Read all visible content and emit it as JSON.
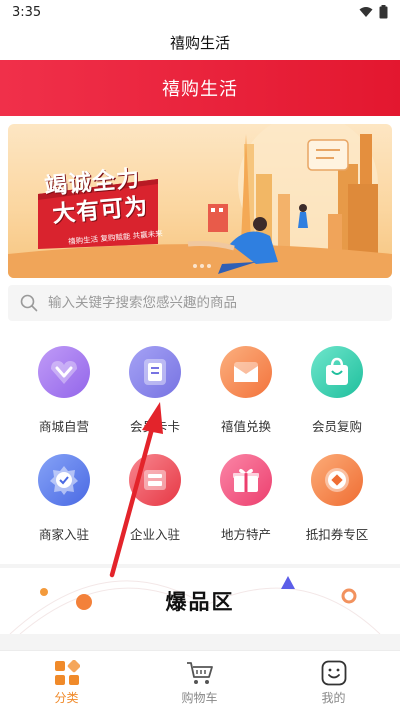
{
  "status_bar": {
    "time": "3:35"
  },
  "header": {
    "title": "禧购生活"
  },
  "red_bar": {
    "title": "禧购生活"
  },
  "banner": {
    "headline_1": "竭诚全力",
    "headline_2": "大有可为",
    "tagline": "禧购生活 复购赋能 共赢未来"
  },
  "search": {
    "placeholder": "输入关键字搜索您感兴趣的商品"
  },
  "grid": {
    "items": [
      {
        "label": "商城自营",
        "icon": "heart-v-icon",
        "color": "#a77cf2"
      },
      {
        "label": "会员卡卡",
        "icon": "member-card-icon",
        "color": "#8b87e8"
      },
      {
        "label": "禧值兑换",
        "icon": "exchange-icon",
        "color": "#f9935a"
      },
      {
        "label": "会员复购",
        "icon": "shopping-bag-icon",
        "color": "#39d3b5"
      },
      {
        "label": "商家入驻",
        "icon": "merchant-badge-icon",
        "color": "#5b7ff0"
      },
      {
        "label": "企业入驻",
        "icon": "enterprise-icon",
        "color": "#ef5560"
      },
      {
        "label": "地方特产",
        "icon": "gift-icon",
        "color": "#f25580"
      },
      {
        "label": "抵扣券专区",
        "icon": "coupon-icon",
        "color": "#f7844a"
      }
    ]
  },
  "hot_section": {
    "title": "爆品区"
  },
  "bottom_nav": {
    "items": [
      {
        "label": "分类",
        "icon": "category-icon",
        "active": true
      },
      {
        "label": "购物车",
        "icon": "cart-icon",
        "active": false
      },
      {
        "label": "我的",
        "icon": "profile-icon",
        "active": false
      }
    ],
    "active_color": "#f08a2a",
    "inactive_color": "#888888"
  }
}
